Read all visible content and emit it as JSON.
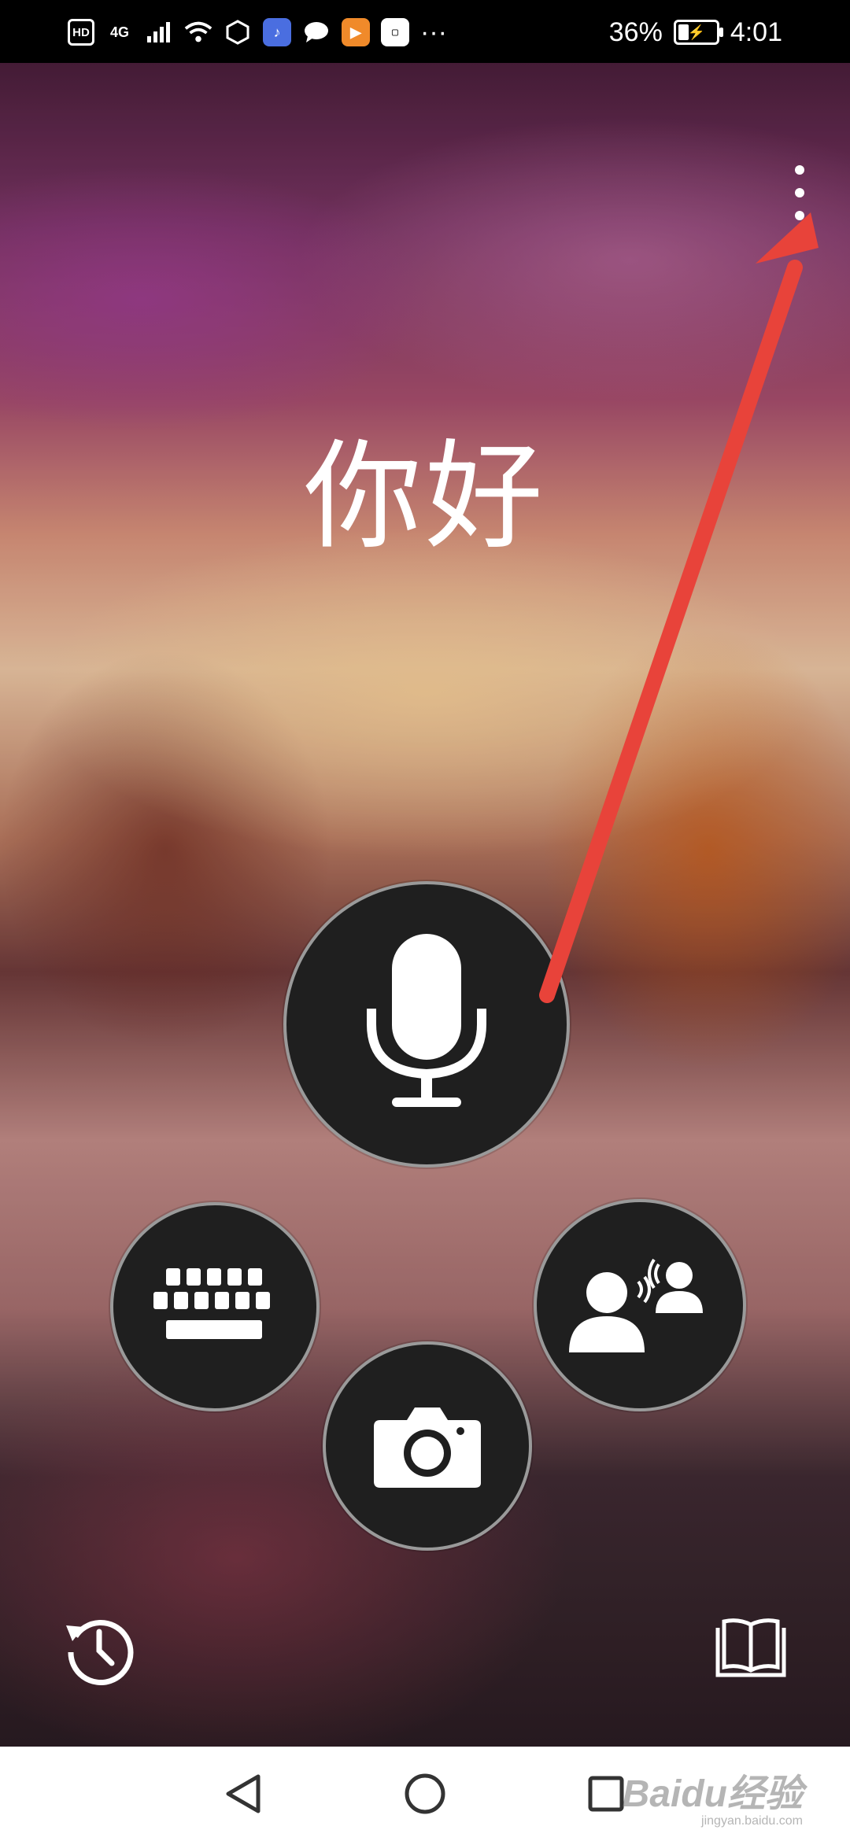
{
  "status_bar": {
    "hd_label": "HD",
    "network_label": "4G",
    "more_label": "···",
    "battery_percent": "36%",
    "battery_level": 0.36,
    "time": "4:01"
  },
  "main": {
    "greeting": "你好"
  },
  "icons": {
    "menu": "more-vertical-icon",
    "mic": "microphone-icon",
    "keyboard": "keyboard-icon",
    "conversation": "conversation-icon",
    "camera": "camera-icon",
    "history": "history-icon",
    "phrasebook": "book-icon"
  },
  "navigation": {
    "back": "back-icon",
    "home": "home-icon",
    "recent": "recent-apps-icon"
  },
  "watermark": {
    "text": "Baidu经验",
    "sub": "jingyan.baidu.com"
  },
  "colors": {
    "button_bg": "#1f1f1f",
    "annotation_arrow": "#e8433a"
  }
}
